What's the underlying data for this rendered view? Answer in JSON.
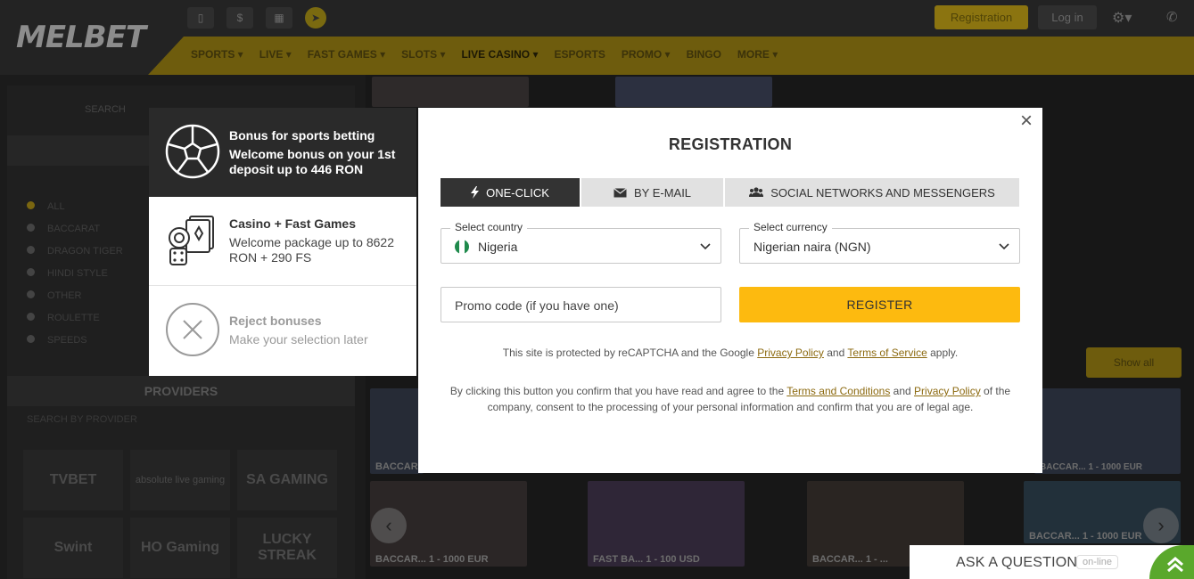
{
  "site": {
    "logo": "MELBET",
    "logo_accent": "",
    "header": {
      "registration": "Registration",
      "login": "Log in"
    },
    "nav": [
      "SPORTS ▾",
      "LIVE ▾",
      "FAST GAMES ▾",
      "SLOTS ▾",
      "LIVE CASINO ▾",
      "ESPORTS",
      "PROMO ▾",
      "BINGO",
      "MORE ▾"
    ],
    "sidebar": {
      "search_label": "SEARCH",
      "categories": [
        "ALL",
        "BACCARAT",
        "DRAGON TIGER",
        "HINDI STYLE",
        "OTHER",
        "ROULETTE",
        "SPEEDS"
      ],
      "providers_title": "PROVIDERS",
      "providers_search": "SEARCH BY PROVIDER",
      "providers": [
        "TVBET",
        "absolute live gaming",
        "SA GAMING",
        "Swint",
        "HO Gaming",
        "LUCKY STREAK"
      ]
    },
    "thumbs": [
      {
        "cap": "BACCAR..."
      },
      {
        "cap": "BACCAR...   1 - 1000 EUR"
      },
      {
        "cap": "BACCAR...   1 - 1000 EUR"
      },
      {
        "cap": "FAST BA...   1 - 100 USD"
      },
      {
        "cap": "BACCAR...   1 - ..."
      },
      {
        "cap": "BACCAR...   1 - 1000 EUR"
      }
    ],
    "show_all": "Show all"
  },
  "bonus_panel": {
    "items": [
      {
        "title": "Bonus for sports betting",
        "desc": "Welcome bonus on your 1st deposit up to 446 RON",
        "icon": "soccer-ball-icon"
      },
      {
        "title": "Casino + Fast Games",
        "desc": "Welcome package up to 8622 RON + 290 FS",
        "icon": "casino-chips-icon"
      },
      {
        "title": "Reject bonuses",
        "desc": "Make your selection later",
        "icon": "reject-icon"
      }
    ]
  },
  "registration": {
    "title": "REGISTRATION",
    "close": "×",
    "tabs": [
      {
        "label": "ONE-CLICK",
        "icon": "lightning-icon"
      },
      {
        "label": "BY E-MAIL",
        "icon": "envelope-icon"
      },
      {
        "label": "SOCIAL NETWORKS AND MESSENGERS",
        "icon": "people-icon"
      }
    ],
    "country": {
      "label": "Select country",
      "value": "Nigeria"
    },
    "currency": {
      "label": "Select currency",
      "value": "Nigerian naira (NGN)"
    },
    "promo": {
      "placeholder": "Promo code (if you have one)"
    },
    "register_label": "REGISTER",
    "recaptcha": {
      "pre": "This site is protected by reCAPTCHA and the Google ",
      "privacy": "Privacy Policy",
      "mid": " and ",
      "terms": "Terms of Service",
      "post": " apply."
    },
    "consent": {
      "pre": "By clicking this button you confirm that you have read and agree to the ",
      "terms": "Terms and Conditions",
      "mid": " and ",
      "privacy": "Privacy Policy",
      "post": " of the company, consent to the processing of your personal information and confirm that you are of legal age."
    }
  },
  "chat": {
    "label": "ASK A QUESTION",
    "status": "on-line"
  },
  "colors": {
    "accent": "#fdba0f",
    "dark_tab": "#333333",
    "link": "#8c6a10",
    "chat_green": "#5aa82c"
  }
}
